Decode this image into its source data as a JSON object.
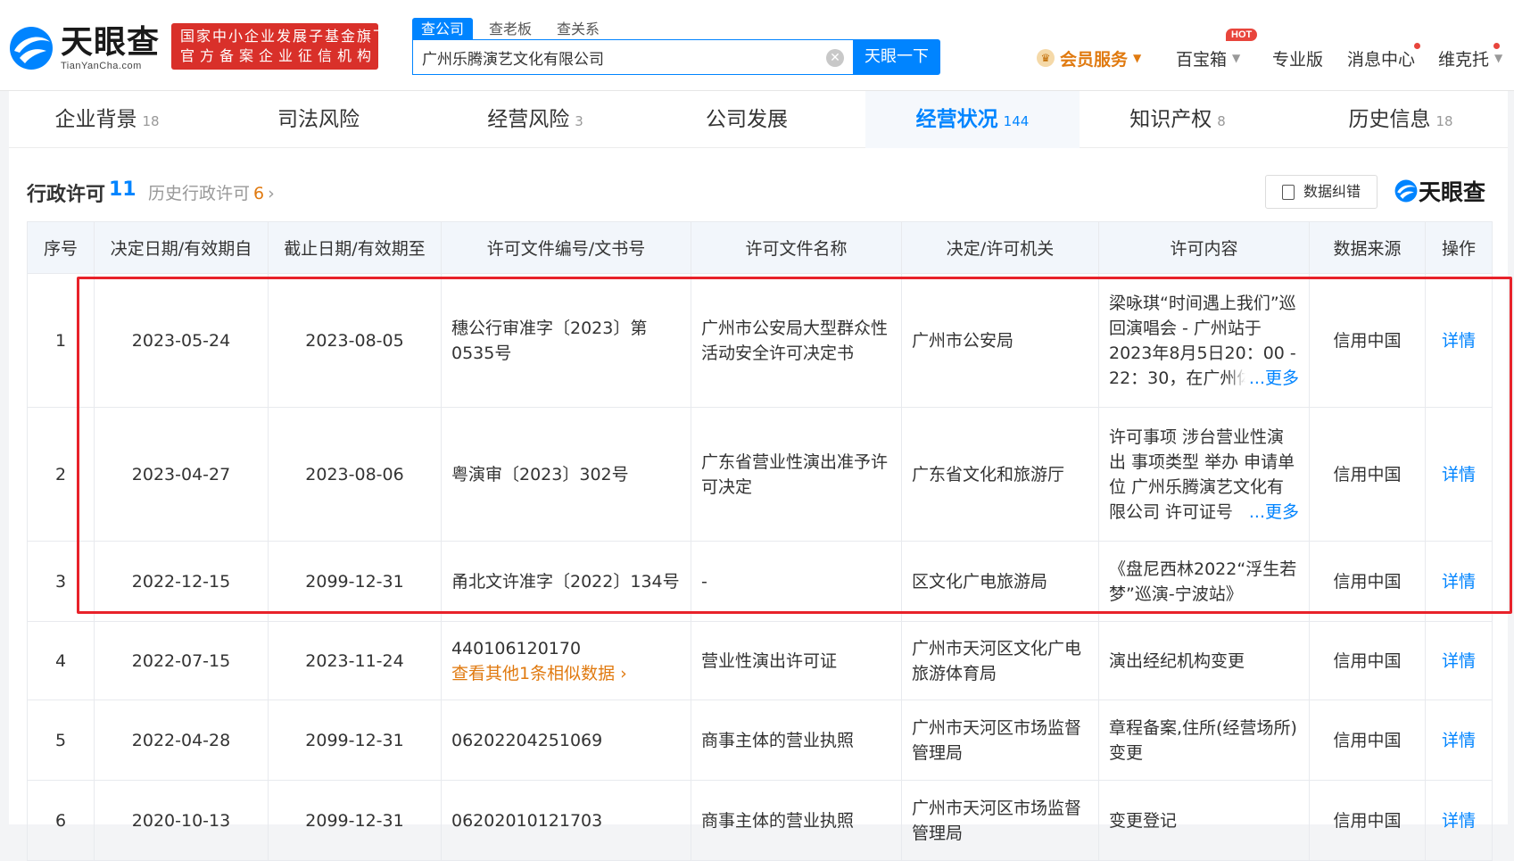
{
  "header": {
    "logo_cn": "天眼查",
    "logo_en": "TianYanCha.com",
    "badge_line1": "国家中小企业发展子基金旗下",
    "badge_line2": "官方备案企业征信机构",
    "search_tabs": [
      "查公司",
      "查老板",
      "查关系"
    ],
    "search_value": "广州乐腾演艺文化有限公司",
    "search_button": "天眼一下",
    "vip": "会员服务",
    "baobox": "百宝箱",
    "hot": "HOT",
    "pro": "专业版",
    "messages": "消息中心",
    "user": "维克托"
  },
  "tabs": [
    {
      "label": "企业背景",
      "count": "18"
    },
    {
      "label": "司法风险",
      "count": ""
    },
    {
      "label": "经营风险",
      "count": "3"
    },
    {
      "label": "公司发展",
      "count": ""
    },
    {
      "label": "经营状况",
      "count": "144"
    },
    {
      "label": "知识产权",
      "count": "8"
    },
    {
      "label": "历史信息",
      "count": "18"
    }
  ],
  "section": {
    "title": "行政许可",
    "count": "11",
    "history_label": "历史行政许可",
    "history_count": "6",
    "correct_button": "数据纠错",
    "brand": "天眼查"
  },
  "table": {
    "headers": [
      "序号",
      "决定日期/有效期自",
      "截止日期/有效期至",
      "许可文件编号/文书号",
      "许可文件名称",
      "决定/许可机关",
      "许可内容",
      "数据来源",
      "操作"
    ],
    "rows": [
      {
        "no": "1",
        "start": "2023-05-24",
        "end": "2023-08-05",
        "doc_no": "穗公行审准字〔2023〕第0535号",
        "doc_name": "广州市公安局大型群众性活动安全许可决定书",
        "authority": "广州市公安局",
        "content": "梁咏琪“时间遇上我们”巡回演唱会 - 广州站于2023年8月5日20：00 - 22：30，在广州体育馆",
        "more": "...更多",
        "source": "信用中国",
        "action": "详情"
      },
      {
        "no": "2",
        "start": "2023-04-27",
        "end": "2023-08-06",
        "doc_no": "粤演审〔2023〕302号",
        "doc_name": "广东省营业性演出准予许可决定",
        "authority": "广东省文化和旅游厅",
        "content": "许可事项 涉台营业性演出 事项类型 举办 申请单位 广州乐腾演艺文化有限公司 许可证号",
        "more": "...更多",
        "source": "信用中国",
        "action": "详情"
      },
      {
        "no": "3",
        "start": "2022-12-15",
        "end": "2099-12-31",
        "doc_no": "甬北文许准字〔2022〕134号",
        "doc_name": "-",
        "authority": "区文化广电旅游局",
        "content": "《盘尼西林2022“浮生若梦”巡演-宁波站》",
        "more": "",
        "source": "信用中国",
        "action": "详情"
      },
      {
        "no": "4",
        "start": "2022-07-15",
        "end": "2023-11-24",
        "doc_no": "440106120170",
        "similar": "查看其他1条相似数据",
        "doc_name": "营业性演出许可证",
        "authority": "广州市天河区文化广电旅游体育局",
        "content": "演出经纪机构变更",
        "more": "",
        "source": "信用中国",
        "action": "详情"
      },
      {
        "no": "5",
        "start": "2022-04-28",
        "end": "2099-12-31",
        "doc_no": "06202204251069",
        "doc_name": "商事主体的营业执照",
        "authority": "广州市天河区市场监督管理局",
        "content": "章程备案,住所(经营场所)变更",
        "more": "",
        "source": "信用中国",
        "action": "详情"
      },
      {
        "no": "6",
        "start": "2020-10-13",
        "end": "2099-12-31",
        "doc_no": "06202010121703",
        "doc_name": "商事主体的营业执照",
        "authority": "广州市天河区市场监督管理局",
        "content": "变更登记",
        "more": "",
        "source": "信用中国",
        "action": "详情"
      }
    ]
  },
  "colors": {
    "accent": "#0084ff",
    "highlight": "#e8222a",
    "orange": "#e07a10"
  }
}
